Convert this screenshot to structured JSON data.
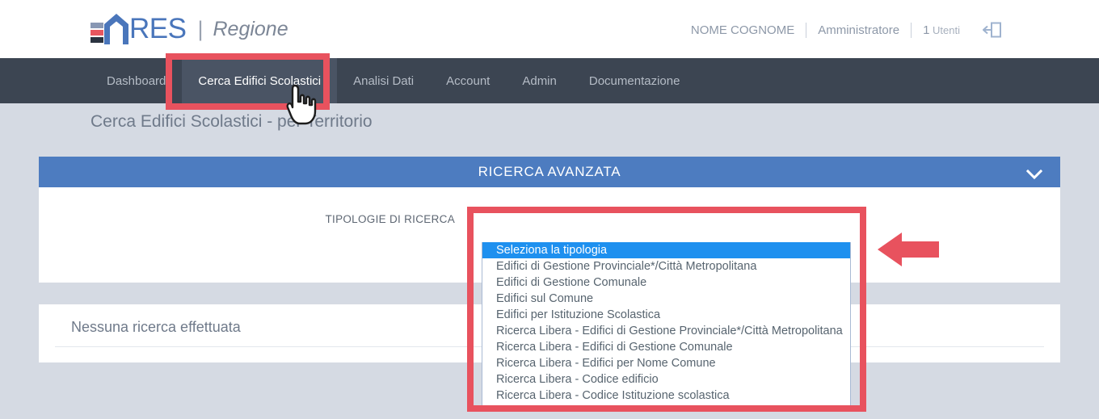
{
  "header": {
    "logo": {
      "bars_icon": "logo-bars-icon",
      "house_icon": "logo-house-icon",
      "text": "RES",
      "separator": "|",
      "subtitle": "Regione"
    },
    "user": {
      "name": "NOME COGNOME",
      "role": "Amministratore",
      "users_count": "1",
      "users_label": "Utenti",
      "logout_icon": "logout-icon"
    }
  },
  "nav": {
    "items": [
      {
        "label": "Dashboard",
        "active": false
      },
      {
        "label": "Cerca Edifici Scolastici",
        "active": true
      },
      {
        "label": "Analisi Dati",
        "active": false
      },
      {
        "label": "Account",
        "active": false
      },
      {
        "label": "Admin",
        "active": false
      },
      {
        "label": "Documentazione",
        "active": false
      }
    ]
  },
  "page": {
    "title": "Cerca Edifici Scolastici - per Territorio"
  },
  "search_panel": {
    "header_title": "RICERCA AVANZATA",
    "collapse_icon": "chevron-down-icon",
    "field_label": "TIPOLOGIE DI RICERCA",
    "select": {
      "value": "Seleziona la tipologia",
      "caret_icon": "caret-down-icon",
      "options": [
        "Seleziona la tipologia",
        "Edifici di Gestione Provinciale*/Città Metropolitana",
        "Edifici di Gestione Comunale",
        "Edifici sul Comune",
        "Edifici per Istituzione Scolastica",
        "Ricerca Libera - Edifici di Gestione Provinciale*/Città Metropolitana",
        "Ricerca Libera - Edifici di Gestione Comunale",
        "Ricerca Libera - Edifici per Nome Comune",
        "Ricerca Libera - Codice edificio",
        "Ricerca Libera - Codice Istituzione scolastica"
      ],
      "selected_index": 0
    }
  },
  "results_panel": {
    "message": "Nessuna ricerca effettuata"
  },
  "annotations": {
    "nav_highlight_name": "annotation-box-nav",
    "dropdown_highlight_name": "annotation-box-dropdown",
    "arrow_name": "annotation-arrow-left",
    "cursor_name": "mouse-cursor-pointer"
  },
  "colors": {
    "annotation_red": "#e8525e",
    "panel_blue": "#4d7cc0",
    "nav_dark": "#3c4552",
    "nav_active": "#4a5464",
    "page_bg": "#d5dae3",
    "select_highlight": "#1e90ef",
    "logo_blue": "#4a76bb"
  }
}
